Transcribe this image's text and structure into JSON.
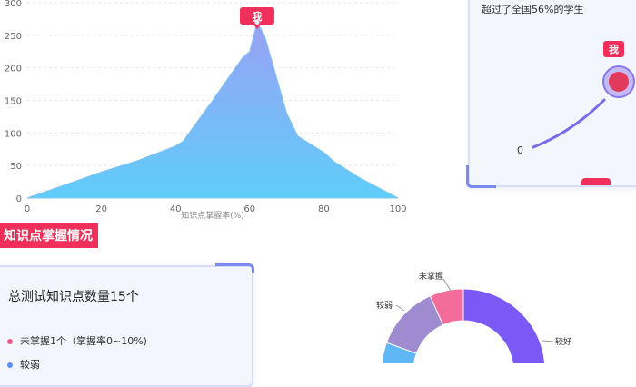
{
  "chart_data": {
    "type": "area",
    "x": [
      0,
      10,
      20,
      30,
      40,
      42,
      50,
      58,
      60,
      62,
      64,
      70,
      73,
      80,
      83,
      90,
      100
    ],
    "y": [
      0,
      20,
      40,
      58,
      80,
      87,
      150,
      215,
      225,
      270,
      250,
      130,
      95,
      70,
      55,
      30,
      0
    ],
    "xticks": [
      "0",
      "20",
      "40",
      "60",
      "80",
      "100"
    ],
    "yticks": [
      "0",
      "50",
      "100",
      "150",
      "200",
      "250",
      "300"
    ],
    "xlim": [
      0,
      100
    ],
    "ylim": [
      0,
      300
    ],
    "xlabel": "知识点掌握率(%)",
    "ylabel": "",
    "marker_label": "我",
    "marker_x": 62,
    "grid": true
  },
  "rank_card": {
    "text": "超过了全国56%的学生",
    "me_label": "我",
    "start_label": "0"
  },
  "section": {
    "tag": "知识点掌握情况"
  },
  "summary_card": {
    "title": "总测试知识点数量15个",
    "rows": [
      {
        "label": "未掌握1个（掌握率0~10%)",
        "color": "#f25a8a"
      },
      {
        "label": "较弱",
        "color": "#5b8ff9"
      }
    ]
  },
  "donut": {
    "labels": {
      "unmastered": "未掌握",
      "weak": "较弱",
      "good": "较好"
    },
    "colors": {
      "unmastered": "#f46c9a",
      "weak": "#9f8cd0",
      "blue": "#5fb8f5",
      "good": "#7b59f6"
    }
  },
  "colors": {
    "accent": "#f0305a",
    "area_top": "#99a3f5",
    "area_bottom": "#5ccaf8"
  }
}
